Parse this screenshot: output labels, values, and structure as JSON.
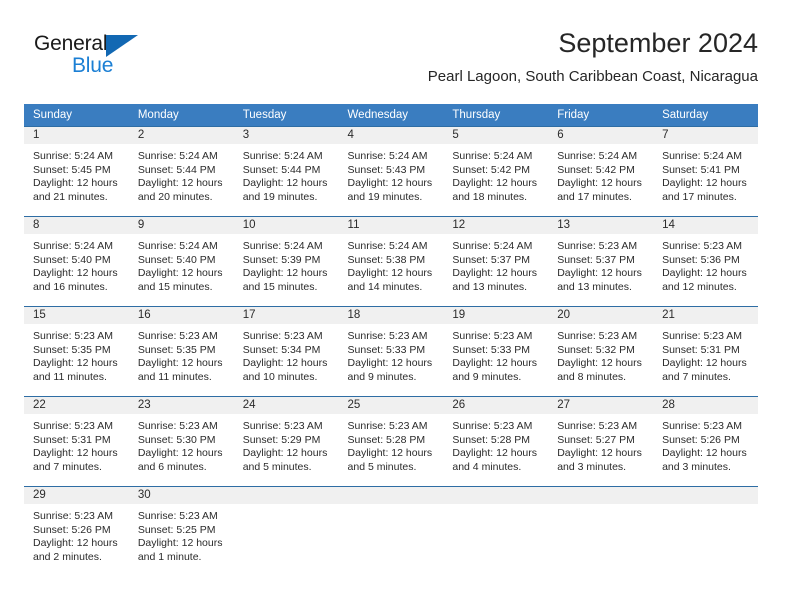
{
  "brand": {
    "name_top": "General",
    "name_bottom": "Blue",
    "accent_color": "#1268b3",
    "accent_light": "#1b7fd4"
  },
  "header": {
    "title": "September 2024",
    "subtitle": "Pearl Lagoon, South Caribbean Coast, Nicaragua"
  },
  "theme": {
    "header_row_bg": "#3a7dc0",
    "day_strip_bg": "#f0f0f0",
    "row_border": "#2e6da4",
    "text": "#2b2b2b"
  },
  "calendar": {
    "weekday_headers": [
      "Sunday",
      "Monday",
      "Tuesday",
      "Wednesday",
      "Thursday",
      "Friday",
      "Saturday"
    ],
    "labels": {
      "sunrise": "Sunrise:",
      "sunset": "Sunset:",
      "daylight": "Daylight:"
    },
    "weeks": [
      [
        {
          "day": "1",
          "sunrise": "Sunrise: 5:24 AM",
          "sunset": "Sunset: 5:45 PM",
          "daylight_a": "Daylight: 12 hours",
          "daylight_b": "and 21 minutes."
        },
        {
          "day": "2",
          "sunrise": "Sunrise: 5:24 AM",
          "sunset": "Sunset: 5:44 PM",
          "daylight_a": "Daylight: 12 hours",
          "daylight_b": "and 20 minutes."
        },
        {
          "day": "3",
          "sunrise": "Sunrise: 5:24 AM",
          "sunset": "Sunset: 5:44 PM",
          "daylight_a": "Daylight: 12 hours",
          "daylight_b": "and 19 minutes."
        },
        {
          "day": "4",
          "sunrise": "Sunrise: 5:24 AM",
          "sunset": "Sunset: 5:43 PM",
          "daylight_a": "Daylight: 12 hours",
          "daylight_b": "and 19 minutes."
        },
        {
          "day": "5",
          "sunrise": "Sunrise: 5:24 AM",
          "sunset": "Sunset: 5:42 PM",
          "daylight_a": "Daylight: 12 hours",
          "daylight_b": "and 18 minutes."
        },
        {
          "day": "6",
          "sunrise": "Sunrise: 5:24 AM",
          "sunset": "Sunset: 5:42 PM",
          "daylight_a": "Daylight: 12 hours",
          "daylight_b": "and 17 minutes."
        },
        {
          "day": "7",
          "sunrise": "Sunrise: 5:24 AM",
          "sunset": "Sunset: 5:41 PM",
          "daylight_a": "Daylight: 12 hours",
          "daylight_b": "and 17 minutes."
        }
      ],
      [
        {
          "day": "8",
          "sunrise": "Sunrise: 5:24 AM",
          "sunset": "Sunset: 5:40 PM",
          "daylight_a": "Daylight: 12 hours",
          "daylight_b": "and 16 minutes."
        },
        {
          "day": "9",
          "sunrise": "Sunrise: 5:24 AM",
          "sunset": "Sunset: 5:40 PM",
          "daylight_a": "Daylight: 12 hours",
          "daylight_b": "and 15 minutes."
        },
        {
          "day": "10",
          "sunrise": "Sunrise: 5:24 AM",
          "sunset": "Sunset: 5:39 PM",
          "daylight_a": "Daylight: 12 hours",
          "daylight_b": "and 15 minutes."
        },
        {
          "day": "11",
          "sunrise": "Sunrise: 5:24 AM",
          "sunset": "Sunset: 5:38 PM",
          "daylight_a": "Daylight: 12 hours",
          "daylight_b": "and 14 minutes."
        },
        {
          "day": "12",
          "sunrise": "Sunrise: 5:24 AM",
          "sunset": "Sunset: 5:37 PM",
          "daylight_a": "Daylight: 12 hours",
          "daylight_b": "and 13 minutes."
        },
        {
          "day": "13",
          "sunrise": "Sunrise: 5:23 AM",
          "sunset": "Sunset: 5:37 PM",
          "daylight_a": "Daylight: 12 hours",
          "daylight_b": "and 13 minutes."
        },
        {
          "day": "14",
          "sunrise": "Sunrise: 5:23 AM",
          "sunset": "Sunset: 5:36 PM",
          "daylight_a": "Daylight: 12 hours",
          "daylight_b": "and 12 minutes."
        }
      ],
      [
        {
          "day": "15",
          "sunrise": "Sunrise: 5:23 AM",
          "sunset": "Sunset: 5:35 PM",
          "daylight_a": "Daylight: 12 hours",
          "daylight_b": "and 11 minutes."
        },
        {
          "day": "16",
          "sunrise": "Sunrise: 5:23 AM",
          "sunset": "Sunset: 5:35 PM",
          "daylight_a": "Daylight: 12 hours",
          "daylight_b": "and 11 minutes."
        },
        {
          "day": "17",
          "sunrise": "Sunrise: 5:23 AM",
          "sunset": "Sunset: 5:34 PM",
          "daylight_a": "Daylight: 12 hours",
          "daylight_b": "and 10 minutes."
        },
        {
          "day": "18",
          "sunrise": "Sunrise: 5:23 AM",
          "sunset": "Sunset: 5:33 PM",
          "daylight_a": "Daylight: 12 hours",
          "daylight_b": "and 9 minutes."
        },
        {
          "day": "19",
          "sunrise": "Sunrise: 5:23 AM",
          "sunset": "Sunset: 5:33 PM",
          "daylight_a": "Daylight: 12 hours",
          "daylight_b": "and 9 minutes."
        },
        {
          "day": "20",
          "sunrise": "Sunrise: 5:23 AM",
          "sunset": "Sunset: 5:32 PM",
          "daylight_a": "Daylight: 12 hours",
          "daylight_b": "and 8 minutes."
        },
        {
          "day": "21",
          "sunrise": "Sunrise: 5:23 AM",
          "sunset": "Sunset: 5:31 PM",
          "daylight_a": "Daylight: 12 hours",
          "daylight_b": "and 7 minutes."
        }
      ],
      [
        {
          "day": "22",
          "sunrise": "Sunrise: 5:23 AM",
          "sunset": "Sunset: 5:31 PM",
          "daylight_a": "Daylight: 12 hours",
          "daylight_b": "and 7 minutes."
        },
        {
          "day": "23",
          "sunrise": "Sunrise: 5:23 AM",
          "sunset": "Sunset: 5:30 PM",
          "daylight_a": "Daylight: 12 hours",
          "daylight_b": "and 6 minutes."
        },
        {
          "day": "24",
          "sunrise": "Sunrise: 5:23 AM",
          "sunset": "Sunset: 5:29 PM",
          "daylight_a": "Daylight: 12 hours",
          "daylight_b": "and 5 minutes."
        },
        {
          "day": "25",
          "sunrise": "Sunrise: 5:23 AM",
          "sunset": "Sunset: 5:28 PM",
          "daylight_a": "Daylight: 12 hours",
          "daylight_b": "and 5 minutes."
        },
        {
          "day": "26",
          "sunrise": "Sunrise: 5:23 AM",
          "sunset": "Sunset: 5:28 PM",
          "daylight_a": "Daylight: 12 hours",
          "daylight_b": "and 4 minutes."
        },
        {
          "day": "27",
          "sunrise": "Sunrise: 5:23 AM",
          "sunset": "Sunset: 5:27 PM",
          "daylight_a": "Daylight: 12 hours",
          "daylight_b": "and 3 minutes."
        },
        {
          "day": "28",
          "sunrise": "Sunrise: 5:23 AM",
          "sunset": "Sunset: 5:26 PM",
          "daylight_a": "Daylight: 12 hours",
          "daylight_b": "and 3 minutes."
        }
      ],
      [
        {
          "day": "29",
          "sunrise": "Sunrise: 5:23 AM",
          "sunset": "Sunset: 5:26 PM",
          "daylight_a": "Daylight: 12 hours",
          "daylight_b": "and 2 minutes."
        },
        {
          "day": "30",
          "sunrise": "Sunrise: 5:23 AM",
          "sunset": "Sunset: 5:25 PM",
          "daylight_a": "Daylight: 12 hours",
          "daylight_b": "and 1 minute."
        },
        {
          "day": "",
          "sunrise": "",
          "sunset": "",
          "daylight_a": "",
          "daylight_b": ""
        },
        {
          "day": "",
          "sunrise": "",
          "sunset": "",
          "daylight_a": "",
          "daylight_b": ""
        },
        {
          "day": "",
          "sunrise": "",
          "sunset": "",
          "daylight_a": "",
          "daylight_b": ""
        },
        {
          "day": "",
          "sunrise": "",
          "sunset": "",
          "daylight_a": "",
          "daylight_b": ""
        },
        {
          "day": "",
          "sunrise": "",
          "sunset": "",
          "daylight_a": "",
          "daylight_b": ""
        }
      ]
    ]
  }
}
